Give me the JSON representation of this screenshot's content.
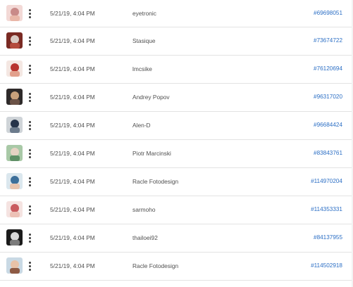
{
  "rows": [
    {
      "date": "5/21/19, 4:04 PM",
      "author": "eyetronic",
      "id": "#69698051",
      "thumb": {
        "bg": "#f3d9d6",
        "fg": "#c98a88",
        "accent": "#e9b7a8"
      },
      "icon": "more-icon"
    },
    {
      "date": "5/21/19, 4:04 PM",
      "author": "Stasique",
      "id": "#73674722",
      "thumb": {
        "bg": "#7a2a23",
        "fg": "#d9c9c2",
        "accent": "#b44a3c"
      },
      "icon": "more-icon"
    },
    {
      "date": "5/21/19, 4:04 PM",
      "author": "lmcsike",
      "id": "#76120694",
      "thumb": {
        "bg": "#f4e7e2",
        "fg": "#b8332e",
        "accent": "#e2a08c"
      },
      "icon": "more-icon"
    },
    {
      "date": "5/21/19, 4:04 PM",
      "author": "Andrey Popov",
      "id": "#96317020",
      "thumb": {
        "bg": "#2e2a2a",
        "fg": "#c9a17c",
        "accent": "#6b5246"
      },
      "icon": "more-icon"
    },
    {
      "date": "5/21/19, 4:04 PM",
      "author": "Alen-D",
      "id": "#96684424",
      "thumb": {
        "bg": "#cfd4d8",
        "fg": "#26344a",
        "accent": "#6c7b8c"
      },
      "icon": "more-icon"
    },
    {
      "date": "5/21/19, 4:04 PM",
      "author": "Piotr Marcinski",
      "id": "#83843761",
      "thumb": {
        "bg": "#a9c9a7",
        "fg": "#e6d2c3",
        "accent": "#5f8f66"
      },
      "icon": "more-icon"
    },
    {
      "date": "5/21/19, 4:04 PM",
      "author": "Racle Fotodesign",
      "id": "#114970204",
      "thumb": {
        "bg": "#dbe7ee",
        "fg": "#3c6f9a",
        "accent": "#e7c4ae"
      },
      "icon": "more-icon"
    },
    {
      "date": "5/21/19, 4:04 PM",
      "author": "sarmoho",
      "id": "#114353331",
      "thumb": {
        "bg": "#f5e3e1",
        "fg": "#c95b5f",
        "accent": "#ecc1b6"
      },
      "icon": "more-icon"
    },
    {
      "date": "5/21/19, 4:04 PM",
      "author": "thailoei92",
      "id": "#84137955",
      "thumb": {
        "bg": "#1b1b1b",
        "fg": "#d8d8d8",
        "accent": "#7b7b7b"
      },
      "icon": "more-icon"
    },
    {
      "date": "5/21/19, 4:04 PM",
      "author": "Racle Fotodesign",
      "id": "#114502918",
      "thumb": {
        "bg": "#c9d9e4",
        "fg": "#e8c2a8",
        "accent": "#8e5a44"
      },
      "icon": "more-icon"
    }
  ]
}
